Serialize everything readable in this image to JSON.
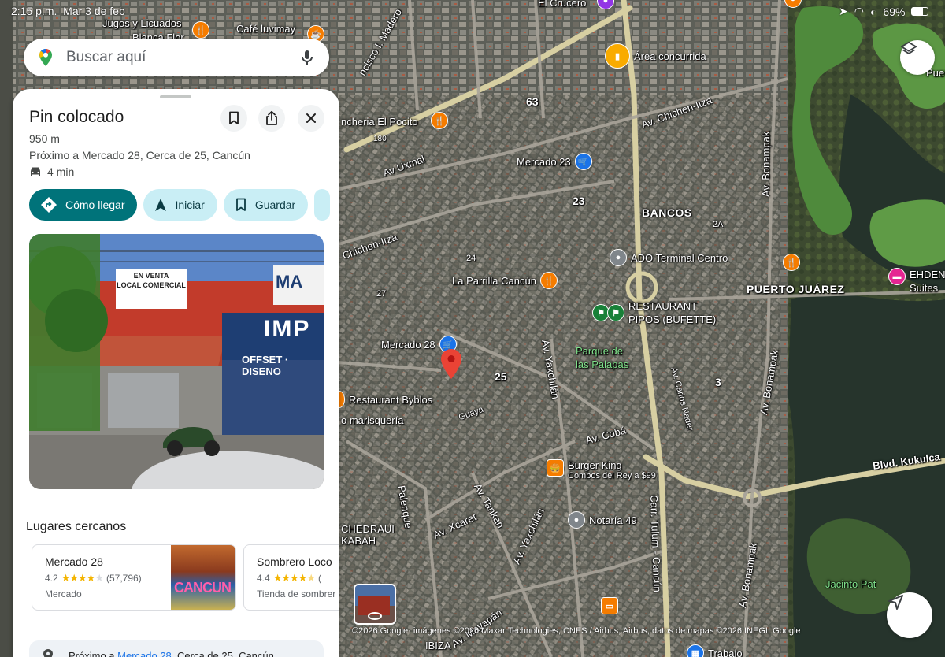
{
  "status_bar": {
    "time": "2:15 p.m.",
    "date": "Mar 3 de feb",
    "battery": "69%"
  },
  "search": {
    "placeholder": "Buscar aquí"
  },
  "place": {
    "title": "Pin colocado",
    "distance": "950 m",
    "address": "Próximo a Mercado 28, Cerca de 25, Cancún",
    "drive_time": "4 min"
  },
  "actions": {
    "directions": "Cómo llegar",
    "start": "Iniciar",
    "save": "Guardar"
  },
  "photo_signs": {
    "sign1": "EN VENTA",
    "sign2": "LOCAL COMERCIAL",
    "sign3": "IMP",
    "sign4": "OFFSET · DISENO",
    "sign5": "MA"
  },
  "nearby": {
    "heading": "Lugares cercanos",
    "items": [
      {
        "name": "Mercado 28",
        "rating": "4.2",
        "reviews": "(57,796)",
        "category": "Mercado",
        "stars": 4.2
      },
      {
        "name": "Sombrero Loco",
        "rating": "4.4",
        "reviews": "(",
        "category": "Tienda de sombrer",
        "stars": 4.4
      }
    ]
  },
  "bottom": {
    "prefix": "Próximo a ",
    "link": "Mercado 28",
    "suffix": ", Cerca de 25, Cancún"
  },
  "map": {
    "labels": {
      "area_concurrida": "Área concurrida",
      "mercado23": "Mercado 23",
      "bancos": "BANCOS",
      "ado": "ADO Terminal Centro",
      "la_parrilla": "La Parrilla Cancún",
      "restaurant_pipos": "RESTAURANT\nPIPOS (BUFETTE)",
      "mercado28": "Mercado 28",
      "parque": "Parque de\nlas Palapas",
      "restaurant_byblos": "Restaurant Byblos",
      "marisqueria": "o marisquería",
      "burger_king": "Burger King",
      "burger_king_sub": "Combos del Rey a $99",
      "notaria": "Notaría 49",
      "puerto_juarez": "PUERTO JUÁREZ",
      "ehden": "EHDEN\nSuites",
      "puerto_j": "Puerto J",
      "jacinto": "Jacinto Pat",
      "trabajo": "Trabajo",
      "jugos": "Jugos y Licuados",
      "blanca": "Blanca Flor",
      "cafe": "Café luvimay",
      "el_crucero": "El Crucero",
      "llanteria": "ncheria El Pocito",
      "chedraui": "CHEDRAUI\nKABAH",
      "ibiza": "IBIZA",
      "av_uxmal": "Av Uxmal",
      "av_chichen": "Av. Chichen-Itza",
      "chichen_left": "Chichen-Itza",
      "av_bonampak": "Av. Bonampak",
      "av_yaxchilan": "Av. Yaxchilán",
      "av_coba": "Av. Cobá",
      "av_tankah": "Av. Tankah",
      "av_xcaret": "Av. Xcaret",
      "av_mayapan": "Av. Mayapán",
      "carr_tulum": "Carr. Tulum - Cancún",
      "blvd_kukulcan": "Blvd. Kukulca",
      "palenque": "Palenque",
      "av_carlos": "Av. Carlos Nader",
      "guaya": "Guaya",
      "francisco_madero": "ncisco I. Madero",
      "n23": "23",
      "n25": "25",
      "n63": "63",
      "n3": "3",
      "n2a": "2A",
      "n24": "24",
      "n27": "27",
      "n180": "180"
    },
    "accent_colors": {
      "food": "#f57c00",
      "shop": "#1a73e8",
      "park": "#188038",
      "hotel": "#e52592",
      "pin": "#ea4335",
      "transit": "#80868b"
    }
  },
  "copyright": "©2026 Google· imágenes ©2026 Maxar Technologies, CNES / Airbus, Airbus, datos de mapas ©2026 INEGI, Google"
}
